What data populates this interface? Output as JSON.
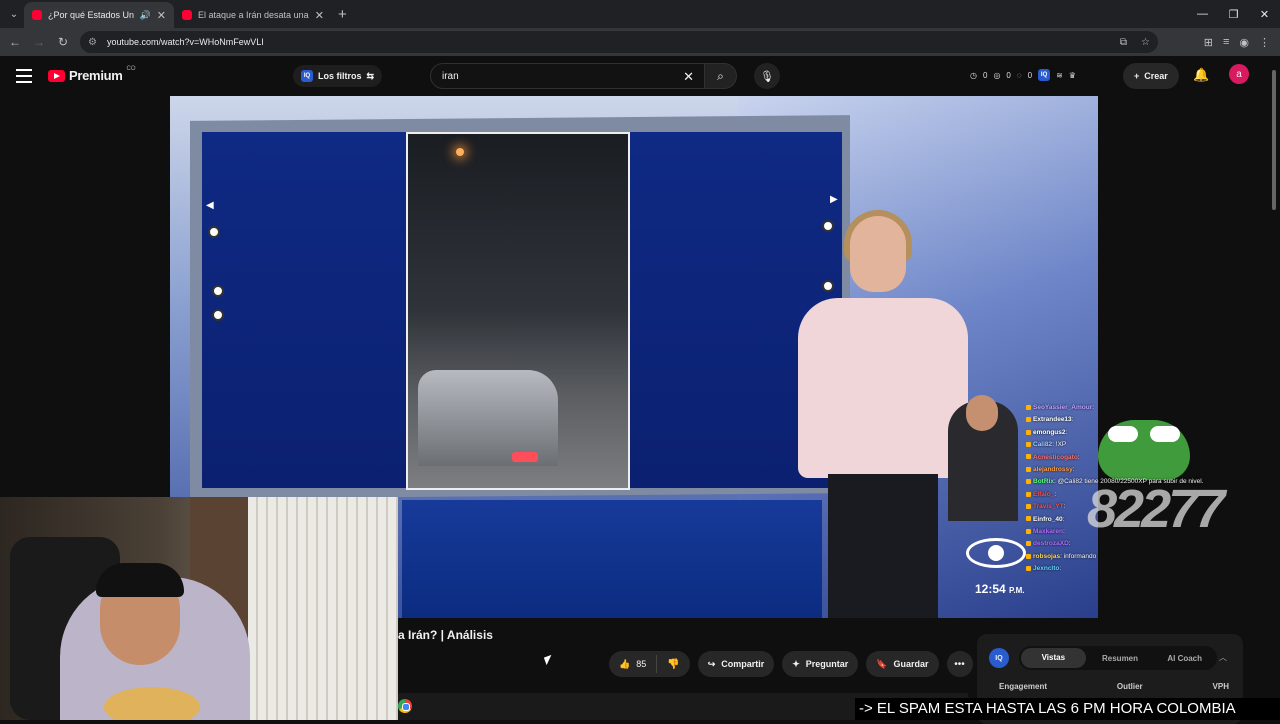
{
  "browser": {
    "tabs": [
      {
        "title": "¿Por qué Estados Unidos e",
        "active": true,
        "audio": true
      },
      {
        "title": "El ataque a Irán desata una gu",
        "active": false
      }
    ],
    "url": "youtube.com/watch?v=WHoNmFewVLI"
  },
  "youtube": {
    "logo_text": "Premium",
    "country": "CO",
    "filters_label": "Los filtros",
    "search_value": "iran",
    "stats": [
      "0",
      "0",
      "0"
    ],
    "create_label": "Crear",
    "avatar_letter": "a"
  },
  "video": {
    "clock": "12:54",
    "clock_suffix": "P.M.",
    "title_visible": "a Irán? | Análisis"
  },
  "actions": {
    "like_count": "85",
    "share_label": "Compartir",
    "ask_label": "Preguntar",
    "save_label": "Guardar"
  },
  "chat": [
    {
      "user": "SeoYassier_Amour",
      "text": "",
      "color": "#b9a3ff"
    },
    {
      "user": "Extrandee13",
      "text": "",
      "color": "#ffffff"
    },
    {
      "user": "emongus2",
      "text": "",
      "color": "#ffffff"
    },
    {
      "user": "Cali82",
      "text": "!XP",
      "color": "#9ec9ff"
    },
    {
      "user": "Acnesticogato",
      "text": "",
      "color": "#ff6e6e"
    },
    {
      "user": "alejandrossy",
      "text": "",
      "color": "#ff9e3d"
    },
    {
      "user": "BotRix",
      "text": "@Cali82 tiene 20080/22500XP para subir de nivel.",
      "color": "#5cff7a"
    },
    {
      "user": "Elfalo_",
      "text": "",
      "color": "#ff4d4d"
    },
    {
      "user": "Travis_YT",
      "text": "",
      "color": "#ff4d4d"
    },
    {
      "user": "Einfro_40",
      "text": "",
      "color": "#ffffff"
    },
    {
      "user": "Maxkaren",
      "text": "",
      "color": "#b06cff"
    },
    {
      "user": "destrozaXD",
      "text": "",
      "color": "#b06cff"
    },
    {
      "user": "robsojas",
      "text": "informando",
      "color": "#ffd94d"
    },
    {
      "user": "Jexnclto",
      "text": "",
      "color": "#5cd6ff"
    }
  ],
  "overlay_number": "82277",
  "vph_panel": {
    "tabs": [
      "Vistas",
      "Resumen",
      "AI Coach"
    ],
    "active_tab": "Vistas",
    "metrics": [
      "Engagement",
      "Outlier",
      "VPH"
    ]
  },
  "ticker": "-> EL SPAM ESTA HASTA LAS 6 PM HORA COLOMBIA"
}
